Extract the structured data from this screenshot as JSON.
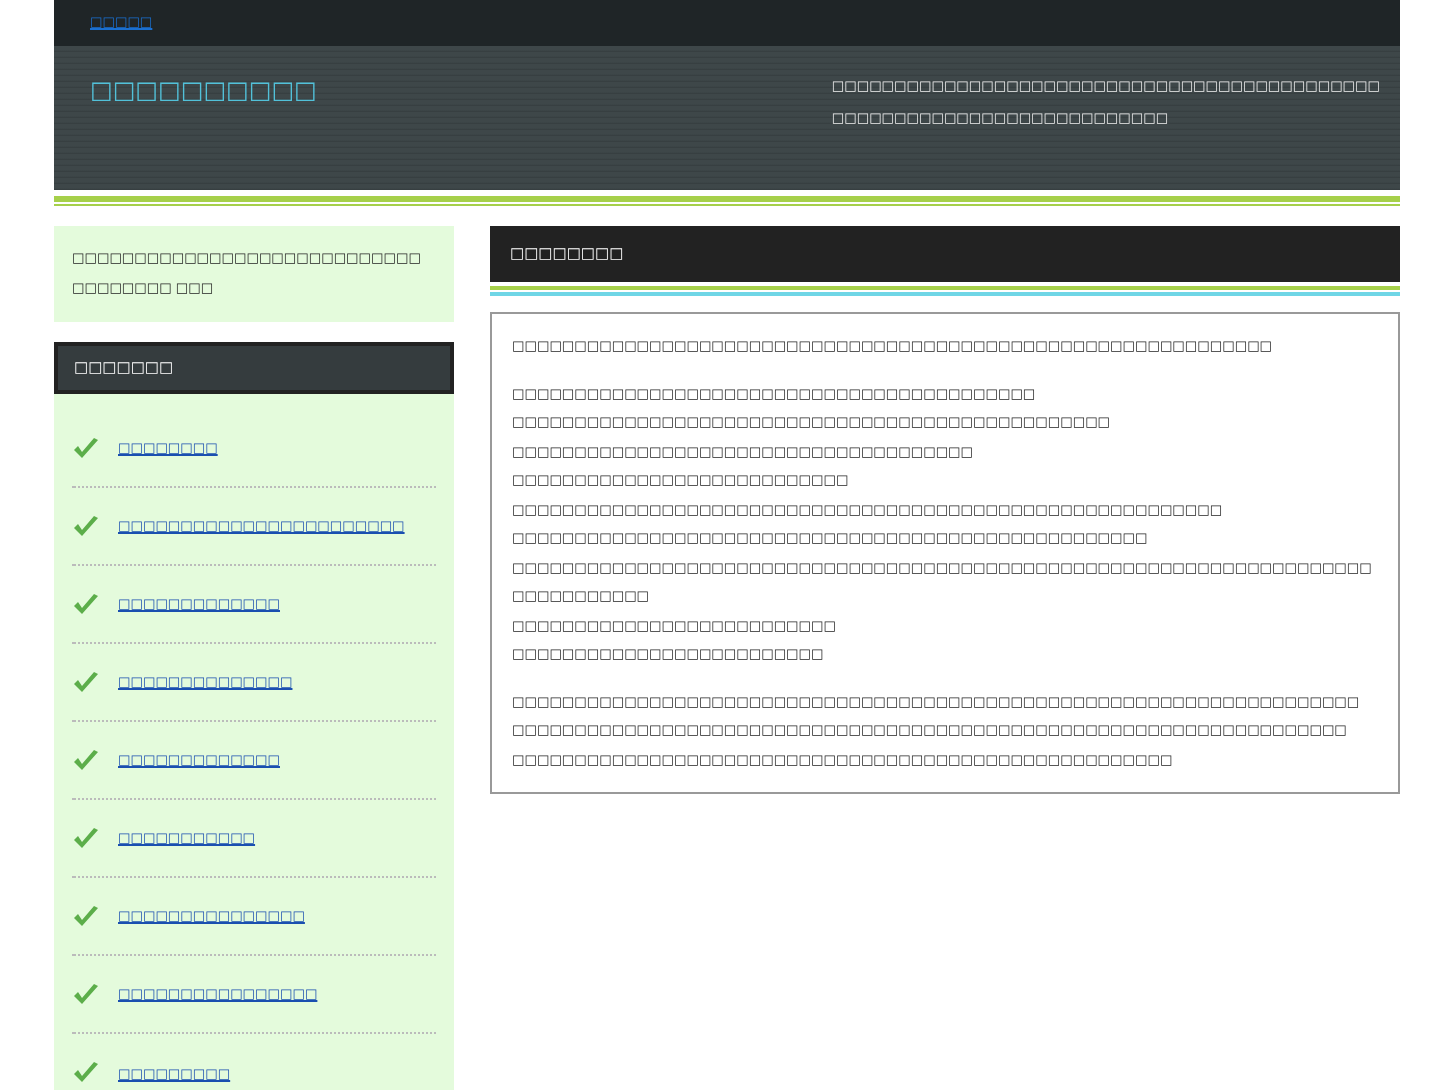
{
  "top_bar": {
    "link": "□□□□□"
  },
  "header": {
    "site_title": "□□□□□□□□□□",
    "description": [
      "□□□□□□□□□□□□□□□□□□□□□□□□□□□□□□□□□□□□□□□□□□□□",
      "□□□□□□□□□□□□□□□□□□□□□□□□□□□"
    ]
  },
  "sidebar": {
    "intro": [
      "□□□□□□□□□□□□□□□□□□□□□□□□□□□□",
      "□□□□□□□□ □□□"
    ],
    "heading": "□□□□□□□",
    "items": [
      "□□□□□□□□",
      "□□□□□□□□□□□□□□□□□□□□□□□",
      "□□□□□□□□□□□□□",
      "□□□□□□□□□□□□□□",
      "□□□□□□□□□□□□□",
      "□□□□□□□□□□□",
      "□□□□□□□□□□□□□□□",
      "□□□□□□□□□□□□□□□□",
      "□□□□□□□□□"
    ]
  },
  "main": {
    "heading": "□□□□□□□□",
    "intro": "□□□□□□□□□□□□□□□□□□□□□□□□□□□□□□□□□□□□□□□□□□□□□□□□□□□□□□□□□□□□□",
    "lines": [
      "□□□□□□□□□□□□□□□□□□□□□□□□□□□□□□□□□□□□□□□□□□",
      "□□□□□□□□□□□□□□□□□□□□□□□□□□□□□□□□□□□□□□□□□□□□□□□□",
      "□□□□□□□□□□□□□□□□□□□□□□□□□□□□□□□□□□□□□",
      "□□□□□□□□□□□□□□□□□□□□□□□□□□□",
      "□□□□□□□□□□□□□□□□□□□□□□□□□□□□□□□□□□□□□□□□□□□□□□□□□□□□□□□□□",
      "□□□□□□□□□□□□□□□□□□□□□□□□□□□□□□□□□□□□□□□□□□□□□□□□□□□",
      "□□□□□□□□□□□□□□□□□□□□□□□□□□□□□□□□□□□□□□□□□□□□□□□□□□□□□□□□□□□□□□□□□□□□□",
      "□□□□□□□□□□□",
      "□□□□□□□□□□□□□□□□□□□□□□□□□□",
      "□□□□□□□□□□□□□□□□□□□□□□□□□"
    ],
    "closing": [
      "□□□□□□□□□□□□□□□□□□□□□□□□□□□□□□□□□□□□□□□□□□□□□□□□□□□□□□□□□□□□□□□□□□□□",
      "□□□□□□□□□□□□□□□□□□□□□□□□□□□□□□□□□□□□□□□□□□□□□□□□□□□□□□□□□□□□□□□□□□□",
      "□□□□□□□□□□□□□□□□□□□□□□□□□□□□□□□□□□□□□□□□□□□□□□□□□□□□□"
    ]
  }
}
